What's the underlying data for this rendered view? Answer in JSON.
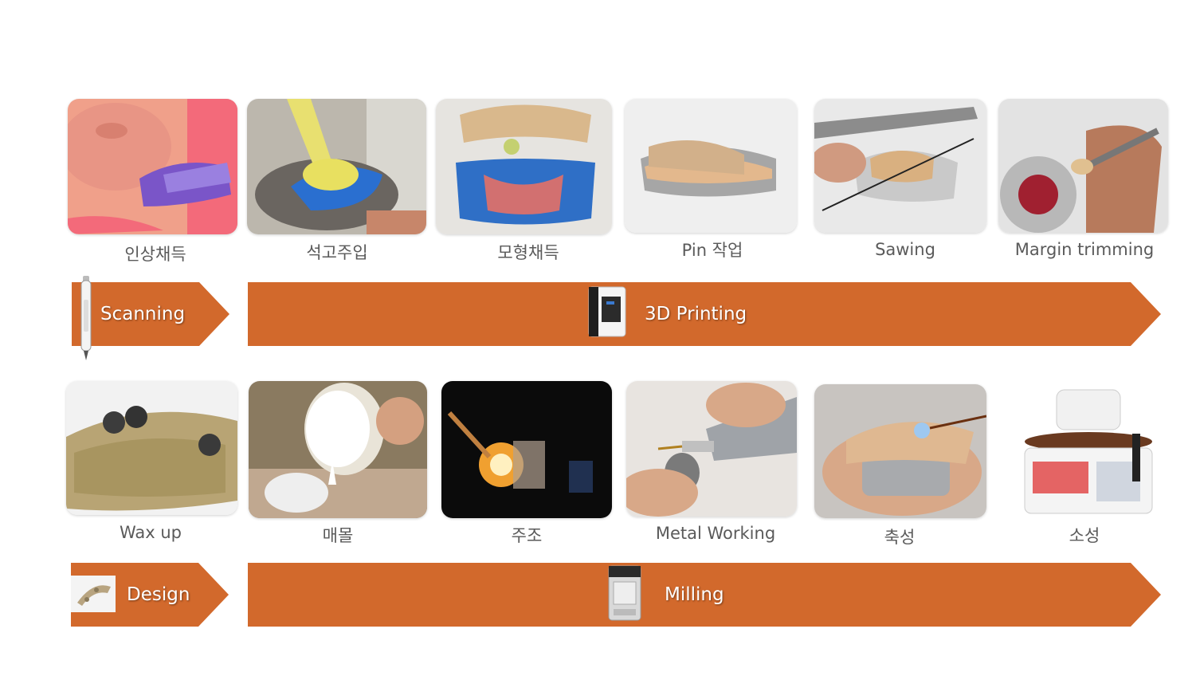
{
  "colors": {
    "arrow": "#d2692c",
    "caption": "#5a5a5a",
    "label": "#ffffff"
  },
  "row1": {
    "captions": [
      "인상채득",
      "석고주입",
      "모형채득",
      "Pin 작업",
      "Sawing",
      "Margin trimming"
    ],
    "left_arrow": {
      "label": "Scanning",
      "icon": "intraoral-scanner-icon"
    },
    "main_arrow": {
      "label": "3D Printing",
      "icon": "3d-printer-icon"
    }
  },
  "row2": {
    "captions": [
      "Wax up",
      "매몰",
      "주조",
      "Metal Working",
      "축성",
      "소성"
    ],
    "left_arrow": {
      "label": "Design",
      "icon": "cad-model-icon"
    },
    "main_arrow": {
      "label": "Milling",
      "icon": "milling-machine-icon"
    }
  }
}
